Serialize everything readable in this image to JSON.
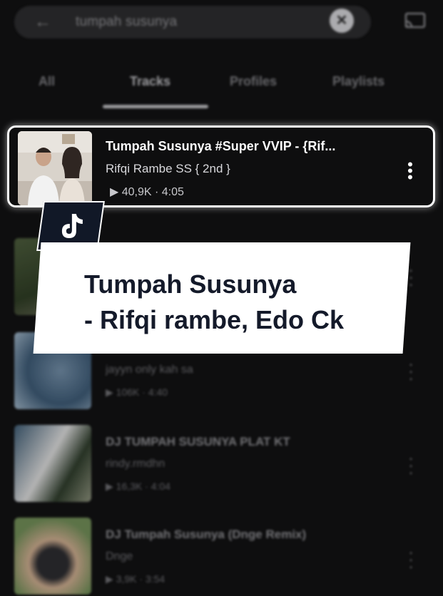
{
  "search": {
    "query": "tumpah susunya",
    "clear_label": "✕"
  },
  "tabs": [
    {
      "label": "All"
    },
    {
      "label": "Tracks"
    },
    {
      "label": "Profiles"
    },
    {
      "label": "Playlists"
    }
  ],
  "highlighted_track": {
    "title": "Tumpah Susunya #Super VVIP - {Rif...",
    "artist": "Rifqi Rambe SS { 2nd }",
    "plays": "40,9K",
    "duration": "4:05",
    "meta": "▶  40,9K · 4:05"
  },
  "tracks": [
    {
      "title": "",
      "artist": "",
      "meta": ""
    },
    {
      "title": "",
      "artist": "jayyn only kah sa",
      "meta": "▶  106K · 4:40"
    },
    {
      "title": "DJ TUMPAH SUSUNYA PLAT KT",
      "artist": "rindy.rmdhn",
      "meta": "▶  16,3K · 4:04"
    },
    {
      "title": "DJ Tumpah Susunya (Dnge Remix)",
      "artist": "Dnge",
      "meta": "▶  3,9K · 3:54"
    }
  ],
  "caption": {
    "text": "Tumpah Susunya\n- Rifqi rambe, Edo Ck"
  },
  "colors": {
    "background": "#0e0e0f",
    "caption_bg": "#ffffff",
    "caption_text": "#141a2a",
    "badge_bg": "#111827"
  }
}
